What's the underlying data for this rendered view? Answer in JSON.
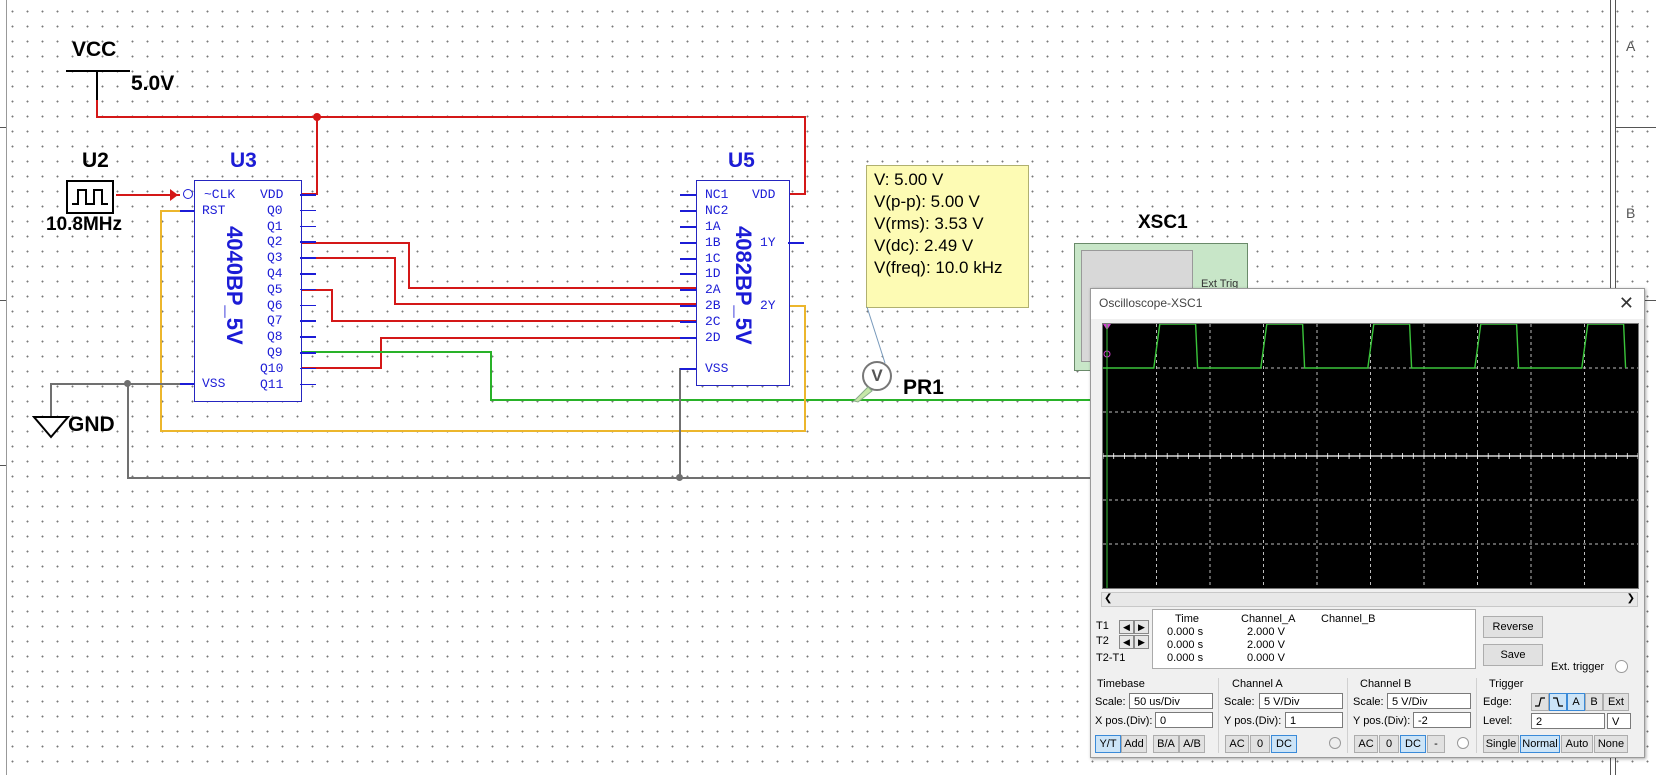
{
  "app": {
    "window_title": "Oscilloscope-XSC1"
  },
  "schematic": {
    "vcc": {
      "name": "VCC",
      "voltage": "5.0V"
    },
    "gnd": {
      "name": "GND"
    },
    "clock": {
      "ref": "U2",
      "freq": "10.8MHz"
    },
    "counter": {
      "ref": "U3",
      "part": "4040BP_5V",
      "left_pins": [
        "~CLK",
        "RST",
        "VSS"
      ],
      "right_pins": [
        "VDD",
        "Q0",
        "Q1",
        "Q2",
        "Q3",
        "Q4",
        "Q5",
        "Q6",
        "Q7",
        "Q8",
        "Q9",
        "Q10",
        "Q11"
      ]
    },
    "andgate": {
      "ref": "U5",
      "part": "4082BP_5V",
      "left_pins": [
        "NC1",
        "NC2",
        "1A",
        "1B",
        "1C",
        "1D",
        "2A",
        "2B",
        "2C",
        "2D",
        "VSS"
      ],
      "right_pins": [
        "VDD",
        "1Y",
        "2Y"
      ]
    },
    "probe": {
      "ref": "PR1",
      "symbol": "V",
      "readings": [
        "V: 5.00 V",
        "V(p-p): 5.00 V",
        "V(rms): 3.53 V",
        "V(dc): 2.49 V",
        "V(freq): 10.0 kHz"
      ]
    },
    "scope": {
      "ref": "XSC1",
      "ext_trig_label": "Ext Trig"
    },
    "border_labels": [
      "A",
      "B"
    ]
  },
  "oscilloscope": {
    "cursors": {
      "t1": "T1",
      "t2": "T2",
      "t2t1": "T2-T1"
    },
    "table": {
      "headers": [
        "Time",
        "Channel_A",
        "Channel_B"
      ],
      "rows": [
        [
          "0.000 s",
          "2.000 V",
          ""
        ],
        [
          "0.000 s",
          "2.000 V",
          ""
        ],
        [
          "0.000 s",
          "0.000 V",
          ""
        ]
      ]
    },
    "buttons": {
      "reverse": "Reverse",
      "save": "Save",
      "ext_trigger": "Ext. trigger"
    },
    "timebase": {
      "title": "Timebase",
      "scale_label": "Scale:",
      "scale": "50 us/Div",
      "xpos_label": "X pos.(Div):",
      "xpos": "0",
      "modes": [
        "Y/T",
        "Add",
        "B/A",
        "A/B"
      ],
      "selected_mode": "Y/T"
    },
    "channel_a": {
      "title": "Channel A",
      "scale_label": "Scale:",
      "scale": "5  V/Div",
      "ypos_label": "Y pos.(Div):",
      "ypos": "1",
      "coupling": [
        "AC",
        "0",
        "DC"
      ],
      "selected": "DC"
    },
    "channel_b": {
      "title": "Channel B",
      "scale_label": "Scale:",
      "scale": "5  V/Div",
      "ypos_label": "Y pos.(Div):",
      "ypos": "-2",
      "coupling": [
        "AC",
        "0",
        "DC",
        "-"
      ],
      "selected": "DC"
    },
    "trigger": {
      "title": "Trigger",
      "edge_label": "Edge:",
      "edges": [
        "rising-edge-icon",
        "falling-edge-icon"
      ],
      "sources": [
        "A",
        "B",
        "Ext"
      ],
      "selected_source": "A",
      "level_label": "Level:",
      "level": "2",
      "level_unit": "V",
      "modes": [
        "Single",
        "Normal",
        "Auto",
        "None"
      ],
      "selected_mode": "Normal"
    },
    "waveform": {
      "channel": "A",
      "color": "#3ac43a",
      "high_div": 1,
      "low_div": 0,
      "trace_color_b": "#ffffff"
    }
  },
  "colors": {
    "wire_red": "#d41818",
    "wire_green": "#29b229",
    "wire_yellow": "#ecb62c",
    "wire_gray": "#707070",
    "component_blue": "#1c1cd6",
    "tooltip_bg": "#fdfbb4"
  }
}
